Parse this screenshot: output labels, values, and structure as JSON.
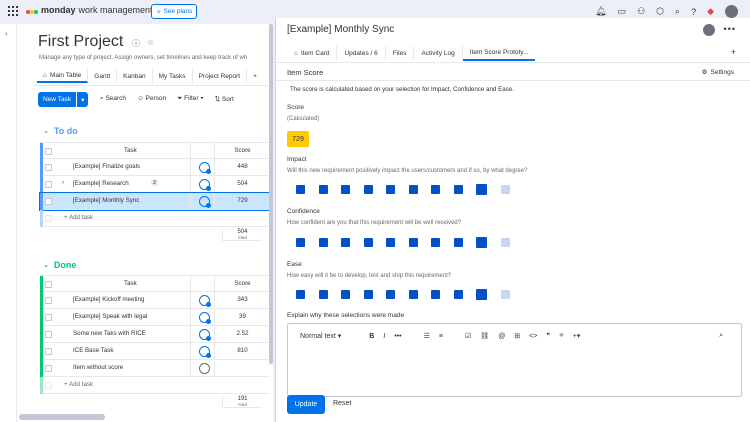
{
  "topbar": {
    "brand_bold": "monday",
    "brand_rest": "work management",
    "see_plans": "See plans"
  },
  "board": {
    "title": "First Project",
    "description": "Manage any type of project. Assign owners, set timelines and keep track of wh",
    "views": [
      "Main Table",
      "Gantt",
      "Kanban",
      "My Tasks",
      "Project Report",
      "+"
    ],
    "new_task": "New Task",
    "toolbar": [
      "Search",
      "Person",
      "Filter",
      "Sort"
    ],
    "groups": [
      {
        "name": "To do",
        "color": "#579bfc",
        "header_task": "Task",
        "header_score": "Score",
        "rows": [
          {
            "task": "[Example] Finalize goals",
            "score": "448",
            "badge": ""
          },
          {
            "task": "[Example] Research",
            "score": "504",
            "badge": "2"
          },
          {
            "task": "[Example] Monthly Sync",
            "score": "729",
            "badge": ""
          }
        ],
        "add_task": "+ Add task",
        "summary_value": "504",
        "summary_label": "med"
      },
      {
        "name": "Done",
        "color": "#00c875",
        "header_task": "Task",
        "header_score": "Score",
        "rows": [
          {
            "task": "[Example] Kickoff meeting",
            "score": "343",
            "badge": ""
          },
          {
            "task": "[Example] Speak with legal",
            "score": "39",
            "badge": ""
          },
          {
            "task": "Some new Taks with RICE",
            "score": "2.52",
            "badge": ""
          },
          {
            "task": "ICE Base Task",
            "score": "810",
            "badge": ""
          },
          {
            "task": "Item without score",
            "score": "",
            "badge": ""
          }
        ],
        "add_task": "+ Add task",
        "summary_value": "191",
        "summary_label": "med"
      }
    ]
  },
  "panel": {
    "title": "[Example] Monthly Sync",
    "tabs": [
      "Item Card",
      "Updates / 6",
      "Files",
      "Activity Log",
      "Item Score Prototy..."
    ],
    "active_tab": 4,
    "section": "Item Score",
    "settings": "Settings",
    "explain": "The score is calculated based on your selection for Impact, Confidence and Ease.",
    "score_label": "Score",
    "score_sub": "(Calculated)",
    "score_value": "729",
    "impact_label": "Impact",
    "impact_question": "Will this new requirement positively impact the users/customers and if so, by what degree?",
    "impact_value": 9,
    "confidence_label": "Confidence",
    "confidence_question": "How confident are you that this requirement will be well received?",
    "confidence_value": 9,
    "ease_label": "Ease",
    "ease_question": "How easy will it be to develop, test and ship this requirement?",
    "ease_value": 9,
    "scale_max": 10,
    "explain_label": "Explain why these selections were made",
    "editor_text_style": "Normal text",
    "update": "Update",
    "reset": "Reset"
  },
  "colors": {
    "accent": "#0073ea",
    "score_badge": "#ffcb00",
    "scale_on": "#0050c8",
    "scale_off": "#c8d6f2"
  }
}
